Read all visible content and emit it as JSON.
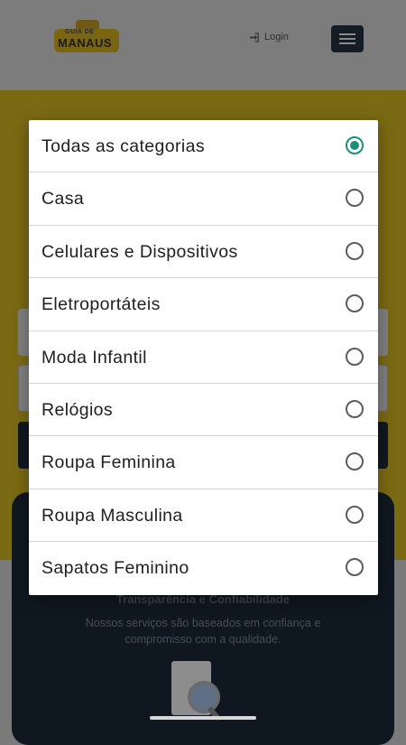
{
  "header": {
    "logo_line1": "GUIA DE",
    "logo_line2": "MANAUS",
    "login_label": "Login"
  },
  "card": {
    "title": "Transparência e Confiabilidade",
    "text": "Nossos serviços são baseados em confiança e compromisso com a qualidade."
  },
  "dialog": {
    "selected_index": 0,
    "options": [
      "Todas as categorias",
      "Casa",
      "Celulares e Dispositivos",
      "Eletroportáteis",
      "Moda Infantil",
      "Relógios",
      "Roupa Feminina",
      "Roupa Masculina",
      "Sapatos Feminino"
    ]
  },
  "colors": {
    "radio_selected": "#1f8f7a",
    "brand_yellow": "#f2cf22",
    "dark_navy": "#1b2a3c"
  }
}
